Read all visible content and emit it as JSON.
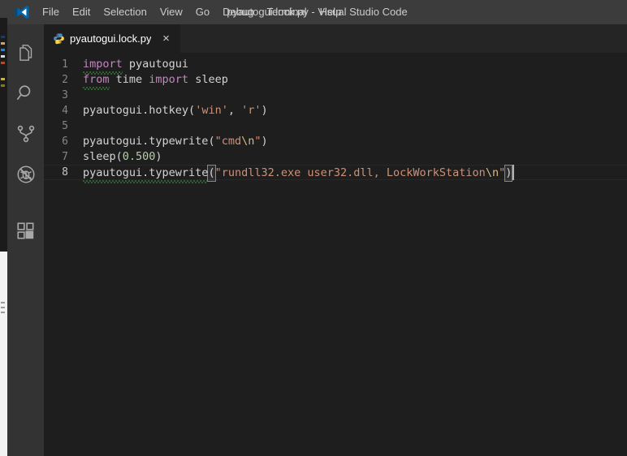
{
  "window": {
    "title": "pyautogui.lock.py - Visual Studio Code",
    "logo_icon": "visual-studio-code-logo"
  },
  "menubar": {
    "items": [
      {
        "label": "File"
      },
      {
        "label": "Edit"
      },
      {
        "label": "Selection"
      },
      {
        "label": "View"
      },
      {
        "label": "Go"
      },
      {
        "label": "Debug"
      },
      {
        "label": "Terminal"
      },
      {
        "label": "Help"
      }
    ]
  },
  "activitybar": {
    "items": [
      {
        "name": "explorer",
        "icon": "files-icon"
      },
      {
        "name": "search",
        "icon": "search-icon"
      },
      {
        "name": "source-control",
        "icon": "source-control-branch-icon"
      },
      {
        "name": "debug",
        "icon": "debug-no-entry-bug-icon"
      },
      {
        "name": "extensions",
        "icon": "extensions-squares-icon"
      }
    ]
  },
  "tabs": [
    {
      "label": "pyautogui.lock.py",
      "icon": "python-file-icon",
      "close_label": "×",
      "active": true
    }
  ],
  "editor": {
    "language": "python",
    "active_line": 8,
    "cursor": {
      "line": 8,
      "column": 58
    },
    "line_numbers": [
      "1",
      "2",
      "3",
      "4",
      "5",
      "6",
      "7",
      "8"
    ],
    "lines": [
      {
        "number": "1",
        "text": "import pyautogui"
      },
      {
        "number": "2",
        "text": "from time import sleep"
      },
      {
        "number": "3",
        "text": ""
      },
      {
        "number": "4",
        "text": "pyautogui.hotkey('win', 'r')"
      },
      {
        "number": "5",
        "text": ""
      },
      {
        "number": "6",
        "text": "pyautogui.typewrite(\"cmd\\n\")"
      },
      {
        "number": "7",
        "text": "sleep(0.500)"
      },
      {
        "number": "8",
        "text": "pyautogui.typewrite(\"rundll32.exe user32.dll, LockWorkStation\\n\")"
      }
    ],
    "tokens": {
      "l1_kw": "import",
      "l1_name": " pyautogui",
      "l2_from": "from",
      "l2_mod": " time ",
      "l2_import": "import",
      "l2_name": " sleep",
      "l4_obj": "pyautogui.hotkey",
      "l4_open": "(",
      "l4_s1": "'win'",
      "l4_comma": ", ",
      "l4_s2": "'r'",
      "l4_close": ")",
      "l6_obj": "pyautogui.typewrite",
      "l6_open": "(",
      "l6_str_a": "\"cmd",
      "l6_esc": "\\n",
      "l6_str_b": "\"",
      "l6_close": ")",
      "l7_fn": "sleep",
      "l7_open": "(",
      "l7_num": "0.500",
      "l7_close": ")",
      "l8_obj": "pyautogui.typewrite",
      "l8_open": "(",
      "l8_str_a": "\"rundll32.exe user32.dll, LockWorkStation",
      "l8_esc": "\\n",
      "l8_str_b": "\"",
      "l8_close": ")"
    }
  },
  "colors": {
    "titlebar_bg": "#3c3c3c",
    "activitybar_bg": "#333333",
    "editor_bg": "#1e1e1e",
    "tabbar_bg": "#252526",
    "keyword": "#c586c0",
    "function": "#dcdcaa",
    "string": "#ce9178",
    "escape": "#d7ba7d",
    "number": "#b5cea8",
    "foreground": "#d4d4d4",
    "line_number": "#858585",
    "warning_squiggle": "#42a046",
    "caret": "#aeafad",
    "vscode_blue": "#0065a9"
  }
}
